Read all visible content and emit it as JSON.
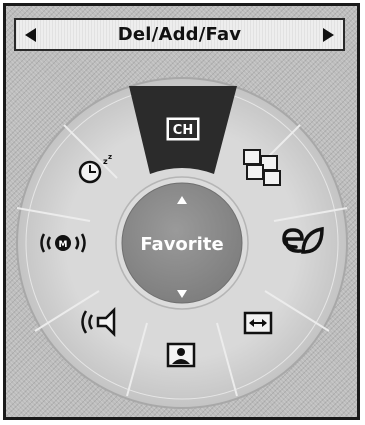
{
  "header": {
    "title": "Del/Add/Fav",
    "prev_icon": "left-triangle-icon",
    "next_icon": "right-triangle-icon"
  },
  "wheel": {
    "center_label": "Favorite",
    "selected": "CH",
    "items": [
      {
        "icon": "channel-icon",
        "label": "CH"
      },
      {
        "icon": "source-icon",
        "label": ""
      },
      {
        "icon": "eco-leaf-icon",
        "label": ""
      },
      {
        "icon": "picture-size-icon",
        "label": ""
      },
      {
        "icon": "picture-mode-icon",
        "label": ""
      },
      {
        "icon": "sound-mode-icon",
        "label": ""
      },
      {
        "icon": "surround-sound-icon",
        "label": ""
      },
      {
        "icon": "sleep-timer-icon",
        "label": ""
      }
    ]
  },
  "colors": {
    "frame_border": "#1a1a1a",
    "background": "#bdbdbd",
    "ring": "#d6d6d6",
    "selection": "#2b2b2b",
    "center": "#8e8e8e"
  }
}
